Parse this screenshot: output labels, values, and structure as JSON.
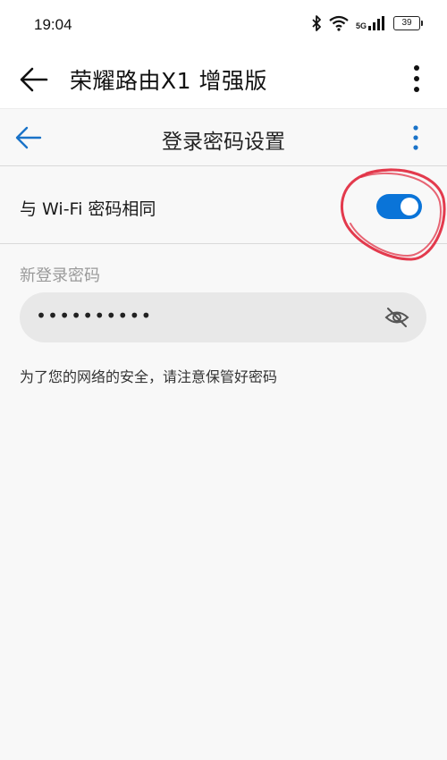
{
  "status_bar": {
    "time": "19:04",
    "network_label": "5G",
    "battery": "39"
  },
  "app_header": {
    "title": "荣耀路由X1 增强版"
  },
  "sub_header": {
    "title": "登录密码设置",
    "accent_color": "#1a73c8"
  },
  "toggle": {
    "label": "与 Wi-Fi 密码相同",
    "state": "on",
    "color": "#0a74d8"
  },
  "password": {
    "label": "新登录密码",
    "value": "••••••••••",
    "visibility_icon": "eye-off-icon"
  },
  "hint": "为了您的网络的安全，请注意保管好密码",
  "annotation_color": "#e0253a"
}
